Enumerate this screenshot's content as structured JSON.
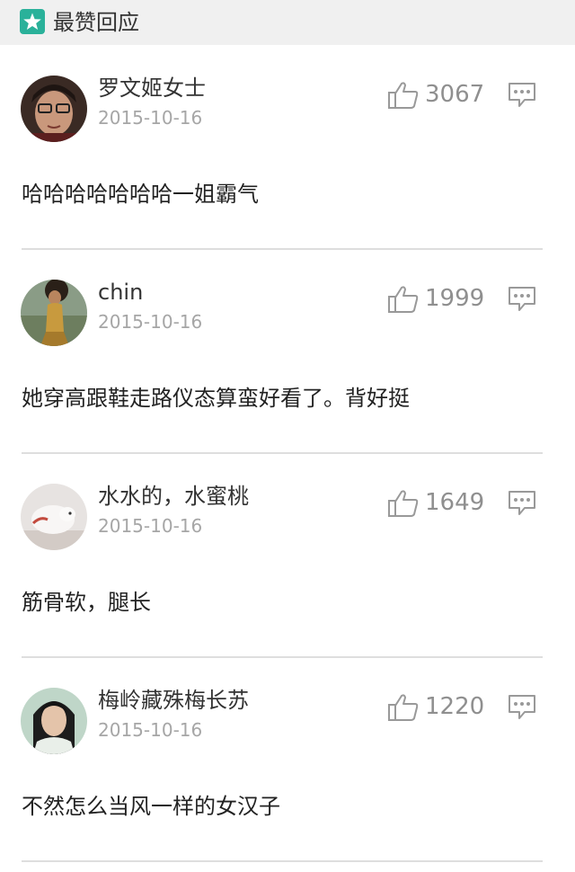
{
  "header": {
    "title": "最赞回应",
    "icon": "star-icon"
  },
  "comments": [
    {
      "user": "罗文姬女士",
      "date": "2015-10-16",
      "likes": "3067",
      "text": "哈哈哈哈哈哈哈一姐霸气"
    },
    {
      "user": "chin",
      "date": "2015-10-16",
      "likes": "1999",
      "text": "她穿高跟鞋走路仪态算蛮好看了。背好挺"
    },
    {
      "user": "水水的，水蜜桃",
      "date": "2015-10-16",
      "likes": "1649",
      "text": "筋骨软，腿长"
    },
    {
      "user": "梅岭藏殊梅长苏",
      "date": "2015-10-16",
      "likes": "1220",
      "text": "不然怎么当风一样的女汉子"
    }
  ],
  "colors": {
    "accent": "#2ab19a",
    "text": "#222222",
    "date": "#a6a6a6",
    "count": "#8f8f8f"
  }
}
